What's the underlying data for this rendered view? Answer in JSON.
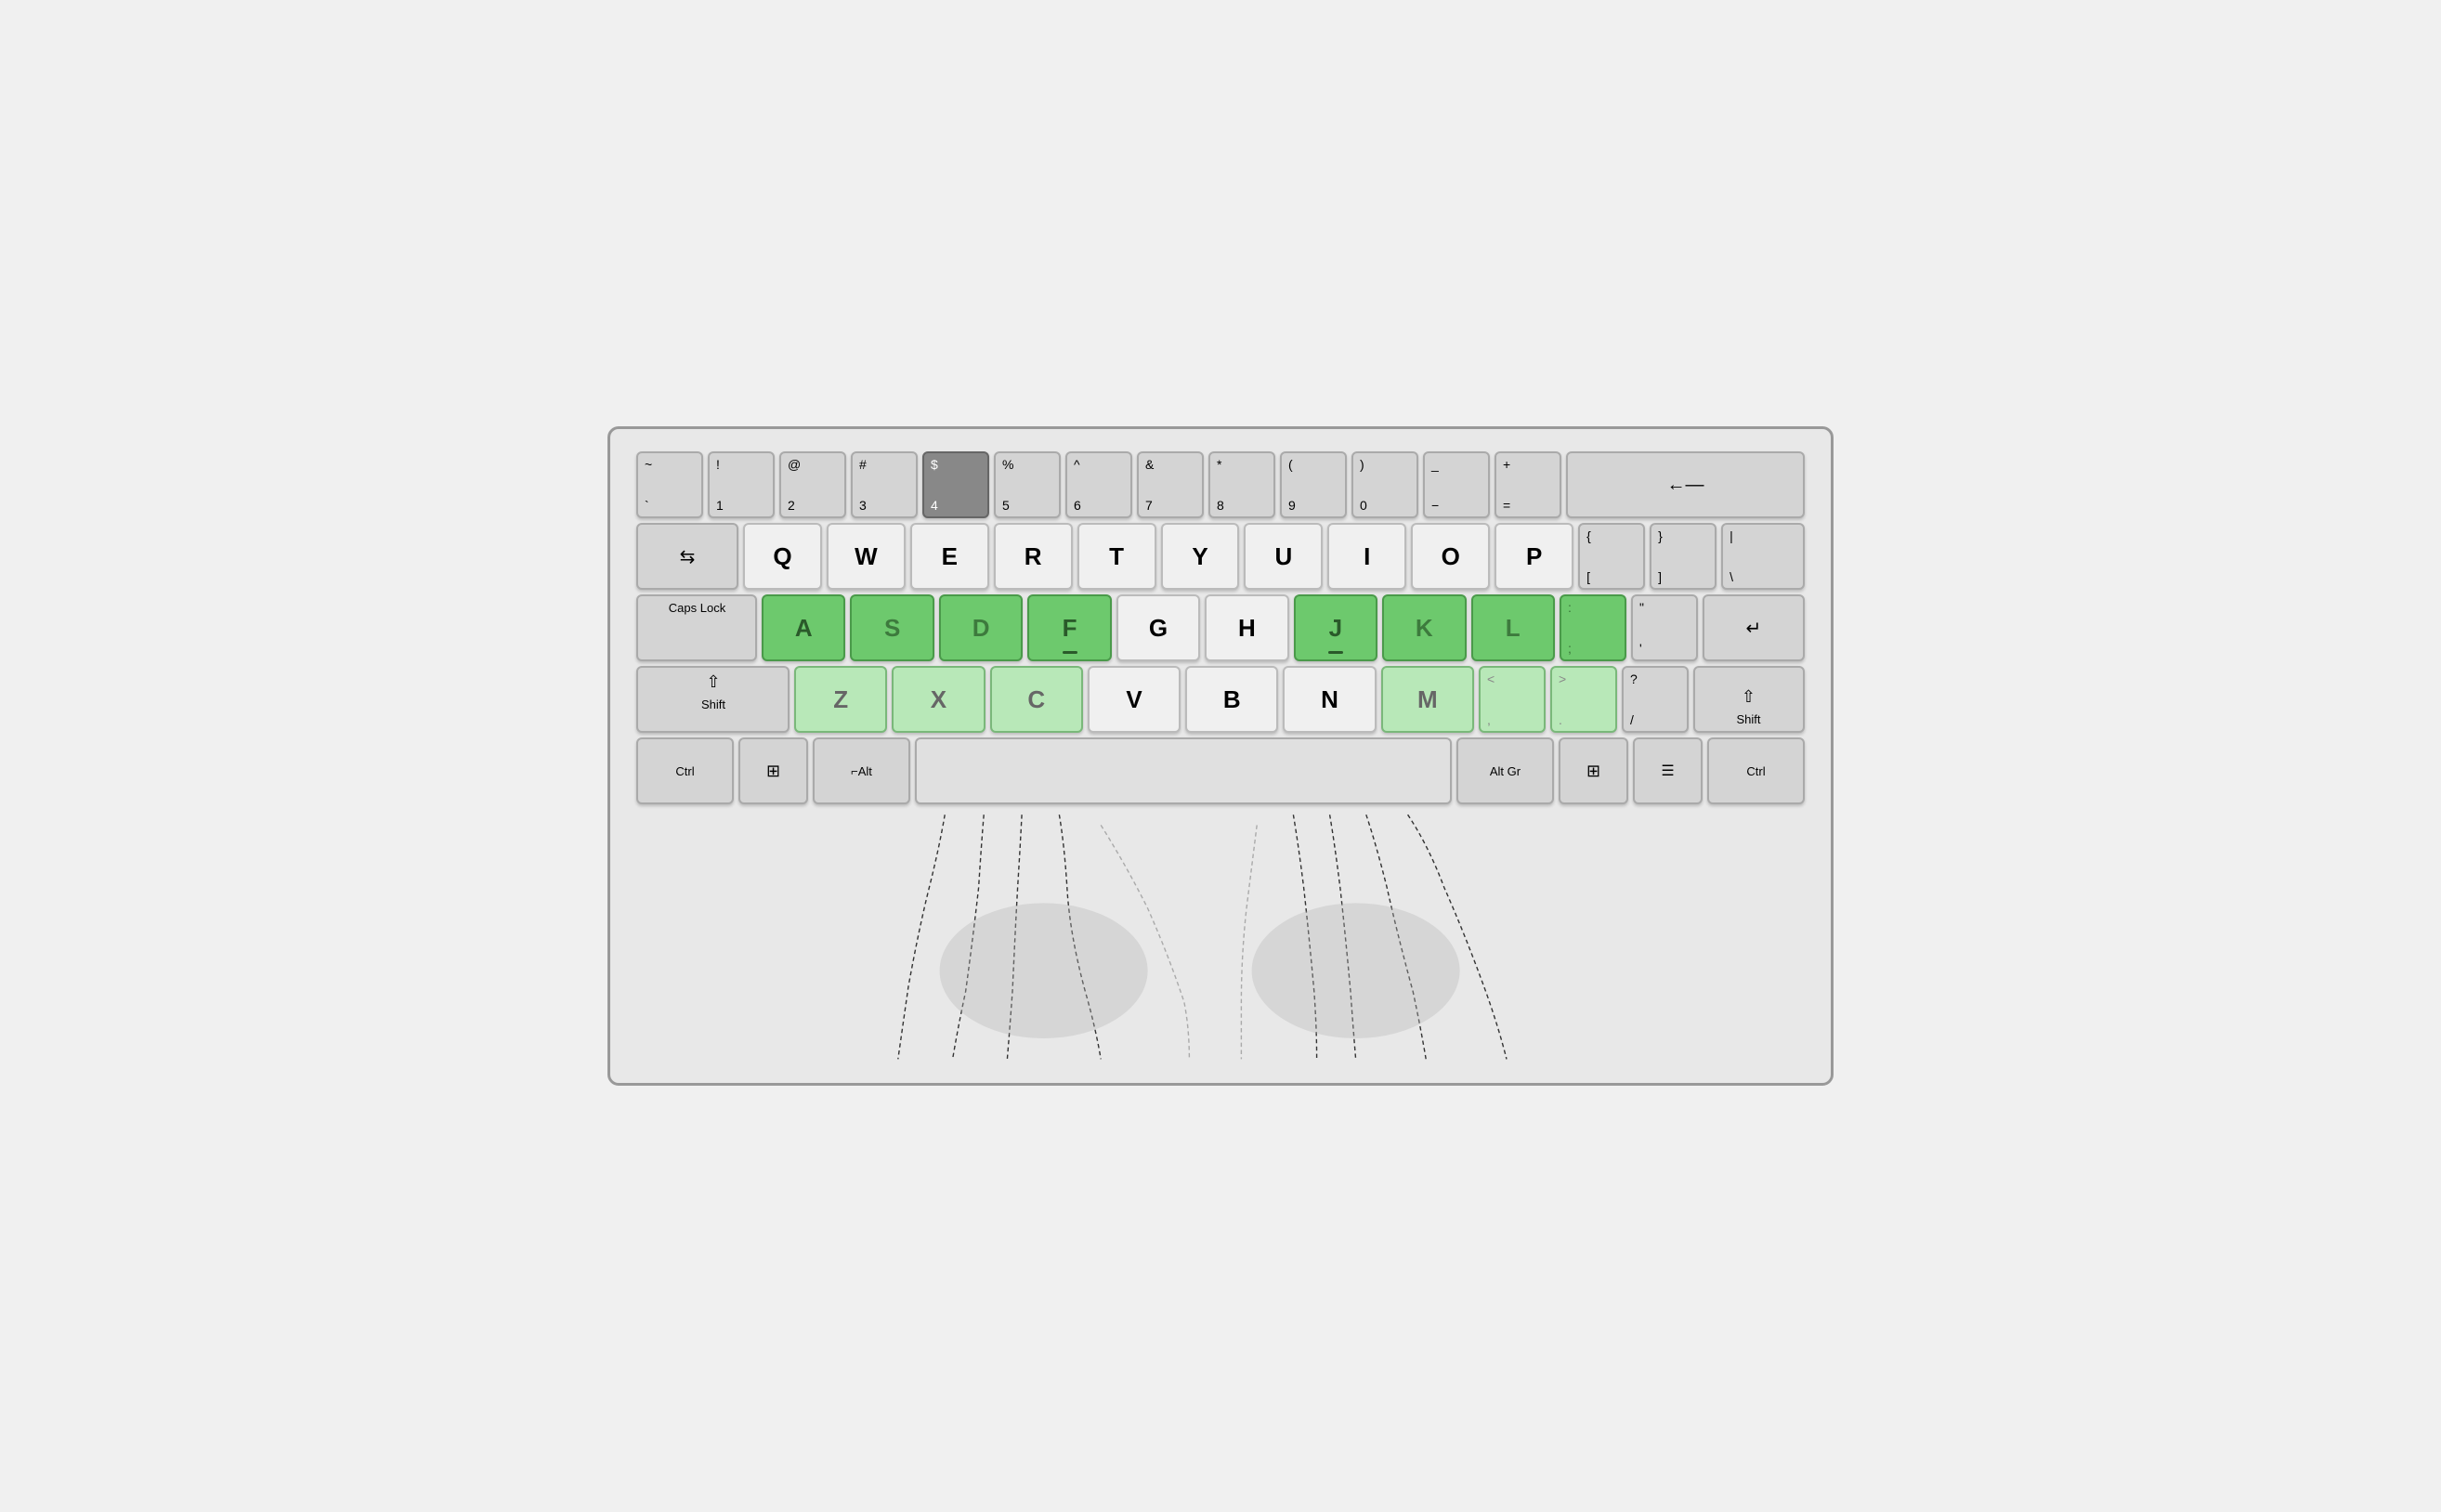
{
  "keyboard": {
    "rows": [
      {
        "id": "row1",
        "keys": [
          {
            "id": "tilde",
            "top": "~",
            "bottom": "`",
            "type": "normal"
          },
          {
            "id": "1",
            "top": "!",
            "bottom": "1",
            "type": "normal"
          },
          {
            "id": "2",
            "top": "@",
            "bottom": "2",
            "type": "normal"
          },
          {
            "id": "3",
            "top": "#",
            "bottom": "3",
            "type": "normal"
          },
          {
            "id": "4",
            "top": "$",
            "bottom": "4",
            "type": "dark"
          },
          {
            "id": "5",
            "top": "%",
            "bottom": "5",
            "type": "normal"
          },
          {
            "id": "6",
            "top": "^",
            "bottom": "6",
            "type": "normal"
          },
          {
            "id": "7",
            "top": "&",
            "bottom": "7",
            "type": "normal"
          },
          {
            "id": "8",
            "top": "*",
            "bottom": "8",
            "type": "normal"
          },
          {
            "id": "9",
            "top": "(",
            "bottom": "9",
            "type": "normal"
          },
          {
            "id": "0",
            "top": ")",
            "bottom": "0",
            "type": "normal"
          },
          {
            "id": "minus",
            "top": "_",
            "bottom": "−",
            "type": "normal"
          },
          {
            "id": "equals",
            "top": "+",
            "bottom": "=",
            "type": "normal"
          },
          {
            "id": "backspace",
            "label": "←—",
            "type": "wide",
            "width": 110
          }
        ]
      },
      {
        "id": "row2",
        "keys": [
          {
            "id": "tab",
            "label": "↹",
            "type": "wide",
            "width": 110
          },
          {
            "id": "q",
            "char": "Q",
            "type": "white"
          },
          {
            "id": "w",
            "char": "W",
            "type": "white"
          },
          {
            "id": "e",
            "char": "E",
            "type": "white"
          },
          {
            "id": "r",
            "char": "R",
            "type": "white"
          },
          {
            "id": "t",
            "char": "T",
            "type": "white"
          },
          {
            "id": "y",
            "char": "Y",
            "type": "white"
          },
          {
            "id": "u",
            "char": "U",
            "type": "white"
          },
          {
            "id": "i",
            "char": "I",
            "type": "white"
          },
          {
            "id": "o",
            "char": "O",
            "type": "white"
          },
          {
            "id": "p",
            "char": "P",
            "type": "white"
          },
          {
            "id": "lbracket",
            "top": "{",
            "bottom": "[",
            "type": "normal"
          },
          {
            "id": "rbracket",
            "top": "}",
            "bottom": "]",
            "type": "normal"
          },
          {
            "id": "backslash2",
            "top": "|",
            "bottom": "\\",
            "type": "normal",
            "width": 90
          }
        ]
      },
      {
        "id": "row3",
        "keys": [
          {
            "id": "capslock",
            "label": "Caps Lock",
            "type": "wide",
            "width": 130
          },
          {
            "id": "a",
            "char": "A",
            "type": "green"
          },
          {
            "id": "s",
            "char": "S",
            "type": "green"
          },
          {
            "id": "d",
            "char": "D",
            "type": "green"
          },
          {
            "id": "f",
            "char": "F",
            "type": "green"
          },
          {
            "id": "g",
            "char": "G",
            "type": "white"
          },
          {
            "id": "h",
            "char": "H",
            "type": "white"
          },
          {
            "id": "j",
            "char": "J",
            "type": "green"
          },
          {
            "id": "k",
            "char": "K",
            "type": "green"
          },
          {
            "id": "l",
            "char": "L",
            "type": "green"
          },
          {
            "id": "semicolon",
            "top": ":",
            "bottom": ";",
            "type": "green"
          },
          {
            "id": "quote",
            "top": "\"",
            "bottom": "'",
            "type": "normal"
          },
          {
            "id": "enter",
            "label": "↵",
            "type": "wide",
            "width": 130
          }
        ]
      },
      {
        "id": "row4",
        "keys": [
          {
            "id": "lshift",
            "label": "Shift ⇧",
            "type": "wide",
            "width": 165
          },
          {
            "id": "z",
            "char": "Z",
            "type": "light-green"
          },
          {
            "id": "x",
            "char": "X",
            "type": "light-green"
          },
          {
            "id": "c",
            "char": "C",
            "type": "light-green"
          },
          {
            "id": "v",
            "char": "V",
            "type": "white"
          },
          {
            "id": "b",
            "char": "B",
            "type": "white"
          },
          {
            "id": "n",
            "char": "N",
            "type": "white"
          },
          {
            "id": "m",
            "char": "M",
            "type": "light-green"
          },
          {
            "id": "comma",
            "top": "<",
            "bottom": ",",
            "type": "light-green"
          },
          {
            "id": "period",
            "top": ">",
            "bottom": ".",
            "type": "light-green"
          },
          {
            "id": "slash",
            "top": "?",
            "bottom": "/",
            "type": "normal"
          },
          {
            "id": "rshift",
            "label": "⇧ Shift",
            "type": "wide",
            "width": 165
          }
        ]
      },
      {
        "id": "row5",
        "keys": [
          {
            "id": "lctrl",
            "label": "Ctrl",
            "type": "wide",
            "width": 105
          },
          {
            "id": "lwin",
            "label": "⊞",
            "type": "normal",
            "width": 75
          },
          {
            "id": "lalt",
            "label": "⌐Alt",
            "type": "wide",
            "width": 105
          },
          {
            "id": "space",
            "label": "",
            "type": "space"
          },
          {
            "id": "altgr",
            "label": "Alt Gr",
            "type": "wide",
            "width": 105
          },
          {
            "id": "rwin",
            "label": "⊞",
            "type": "normal",
            "width": 75
          },
          {
            "id": "menu",
            "label": "☰",
            "type": "normal",
            "width": 75
          },
          {
            "id": "rctrl",
            "label": "Ctrl",
            "type": "wide",
            "width": 105
          }
        ]
      }
    ]
  },
  "fingers": {
    "description": "Finger position outlines shown as dashed curves below the keyboard"
  }
}
